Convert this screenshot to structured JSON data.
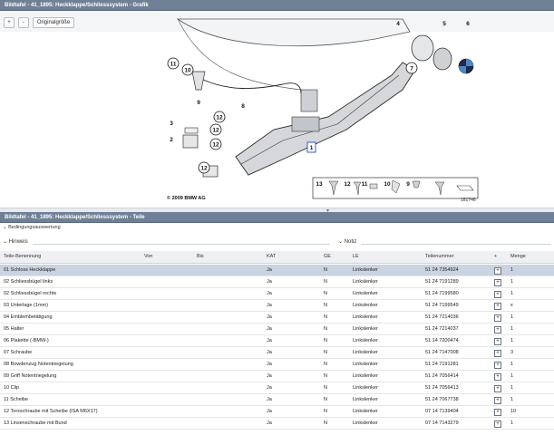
{
  "window": {
    "title_top": "Bildtafel - 41_1895: Heckklappe/Schliesssystem - Grafik",
    "title_bottom": "Bildtafel - 41_1895: Heckklappe/Schliesssystem - Teile"
  },
  "toolbar": {
    "plus_label": "+",
    "minus_label": "-",
    "original_label": "Originalgröße"
  },
  "diagram": {
    "copyright": "© 2009 BMW AG",
    "image_id": "181746",
    "callouts": [
      "11",
      "10",
      "9",
      "8",
      "3",
      "12",
      "2",
      "12",
      "12",
      "12",
      "1",
      "4",
      "5",
      "6",
      "7"
    ],
    "legend": [
      "13",
      "12",
      "11",
      "10",
      "9"
    ]
  },
  "splitter": {
    "grip": "▾"
  },
  "conditions": {
    "label": "Bedingungsauswertung"
  },
  "hints": {
    "left_label": "Hinweis",
    "right_label": "Notiz"
  },
  "table": {
    "headers": {
      "name": "Teile-Benennung",
      "von": "Von",
      "bis": "Bis",
      "kat": "KAT",
      "ge": "GE",
      "le": "LE",
      "teilenummer": "Teilenummer",
      "cart": "+",
      "menge": "Menge"
    },
    "rows": [
      {
        "name": "01 Schloss Heckklappe",
        "kat": "Ja",
        "ge": "N",
        "le": "Linkslenker",
        "tn": "51 24 7354924",
        "cart": "+",
        "menge": "1"
      },
      {
        "name": "02 Schliessbügel links",
        "kat": "Ja",
        "ge": "N",
        "le": "Linkslenker",
        "tn": "51 24 7191289",
        "cart": "+",
        "menge": "1"
      },
      {
        "name": "02 Schliessbügel rechts",
        "kat": "Ja",
        "ge": "N",
        "le": "Linkslenker",
        "tn": "51 24 7199580",
        "cart": "+",
        "menge": "1"
      },
      {
        "name": "03 Unterlage (1mm)",
        "kat": "Ja",
        "ge": "N",
        "le": "Linkslenker",
        "tn": "51 24 7199549",
        "cart": "+",
        "menge": "x"
      },
      {
        "name": "04 Emblembetätigung",
        "kat": "Ja",
        "ge": "N",
        "le": "Linkslenker",
        "tn": "51 24 7214036",
        "cart": "+",
        "menge": "1"
      },
      {
        "name": "05 Halter",
        "kat": "Ja",
        "ge": "N",
        "le": "Linkslenker",
        "tn": "51 24 7214037",
        "cart": "+",
        "menge": "1"
      },
      {
        "name": "06 Plakette (-BMW-)",
        "kat": "Ja",
        "ge": "N",
        "le": "Linkslenker",
        "tn": "51 14 7200474",
        "cart": "+",
        "menge": "1"
      },
      {
        "name": "07 Schraube",
        "kat": "Ja",
        "ge": "N",
        "le": "Linkslenker",
        "tn": "51 24 7147008",
        "cart": "+",
        "menge": "3"
      },
      {
        "name": "08 Bowdenzug Notentriegelung",
        "kat": "Ja",
        "ge": "N",
        "le": "Linkslenker",
        "tn": "51 24 7191281",
        "cart": "+",
        "menge": "1"
      },
      {
        "name": "09 Griff Notentriegelung",
        "kat": "Ja",
        "ge": "N",
        "le": "Linkslenker",
        "tn": "51 24 7056414",
        "cart": "+",
        "menge": "1"
      },
      {
        "name": "10 Clip",
        "kat": "Ja",
        "ge": "N",
        "le": "Linkslenker",
        "tn": "51 24 7056413",
        "cart": "+",
        "menge": "1"
      },
      {
        "name": "11 Scheibe",
        "kat": "Ja",
        "ge": "N",
        "le": "Linkslenker",
        "tn": "51 24 7067738",
        "cart": "+",
        "menge": "1"
      },
      {
        "name": "12 Torxschraube mit Scheibe (ISA M6X17)",
        "kat": "Ja",
        "ge": "N",
        "le": "Linkslenker",
        "tn": "07 14 7139404",
        "cart": "+",
        "menge": "10"
      },
      {
        "name": "13 Linsenschraube mit Bund",
        "kat": "Ja",
        "ge": "N",
        "le": "Linkslenker",
        "tn": "07 14 7143279",
        "cart": "+",
        "menge": "1"
      }
    ]
  }
}
